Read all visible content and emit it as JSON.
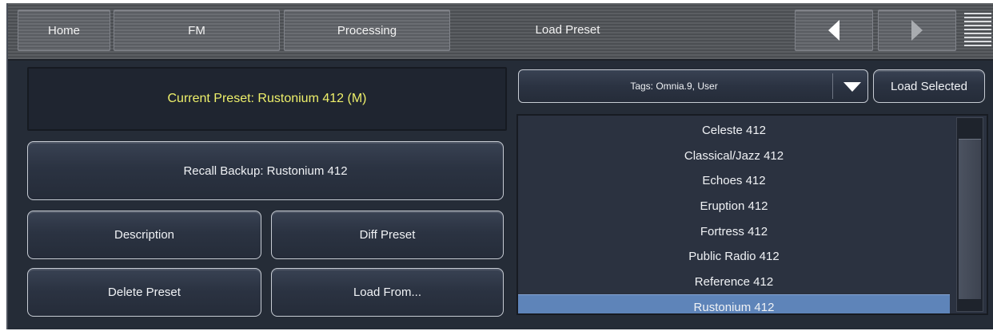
{
  "nav": {
    "home_label": "Home",
    "fm_label": "FM",
    "processing_label": "Processing",
    "title": "Load Preset"
  },
  "current_preset": "Current Preset: Rustonium 412 (M)",
  "buttons": {
    "recall_backup": "Recall Backup: Rustonium 412",
    "description": "Description",
    "diff_preset": "Diff Preset",
    "delete_preset": "Delete Preset",
    "load_from": "Load From...",
    "load_selected": "Load Selected"
  },
  "tags_filter": "Tags: Omnia.9, User",
  "preset_list": {
    "items": [
      "Celeste 412",
      "Classical/Jazz 412",
      "Echoes 412",
      "Eruption 412",
      "Fortress 412",
      "Public Radio 412",
      "Reference 412",
      "Rustonium 412"
    ],
    "selected": "Rustonium 412"
  },
  "colors": {
    "current_preset_text": "#eef06a",
    "selection_bg": "#5e84b9",
    "panel_bg": "#252c37"
  }
}
